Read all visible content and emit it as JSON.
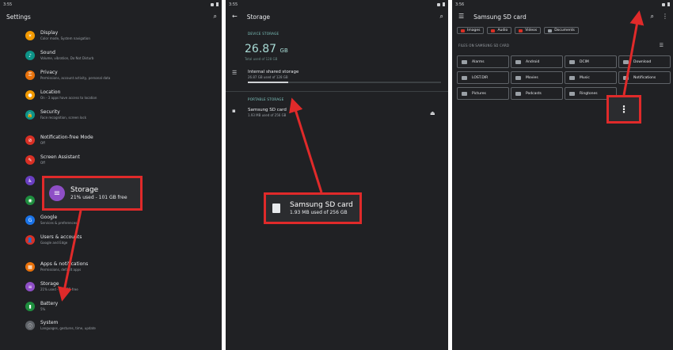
{
  "screen1": {
    "status_time": "3:55",
    "title": "Settings",
    "items": [
      {
        "title": "Display",
        "sub": "Color mode, System navigation",
        "color": "#f29900",
        "glyph": "☀"
      },
      {
        "title": "Sound",
        "sub": "Volume, vibration, Do Not Disturb",
        "color": "#0d9488",
        "glyph": "♪"
      },
      {
        "title": "Privacy",
        "sub": "Permissions, account activity, personal data",
        "color": "#e8710a",
        "glyph": "⚿"
      },
      {
        "title": "Location",
        "sub": "On - 3 apps have access to location",
        "color": "#f29900",
        "glyph": "●"
      },
      {
        "title": "Security",
        "sub": "Face recognition, screen lock",
        "color": "#0d9488",
        "glyph": "🔒"
      },
      {
        "title": "Notification-free Mode",
        "sub": "Off",
        "color": "#d93025",
        "glyph": "⊘"
      },
      {
        "title": "Screen Assistant",
        "sub": "Off",
        "color": "#d93025",
        "glyph": "✎"
      },
      {
        "title": "",
        "sub": "",
        "color": "#6a3fc2",
        "glyph": "♿"
      },
      {
        "title": "",
        "sub": "",
        "color": "#1e8e3e",
        "glyph": "◉"
      },
      {
        "title": "Google",
        "sub": "Services & preferences",
        "color": "#1a73e8",
        "glyph": "G"
      },
      {
        "title": "Users & accounts",
        "sub": "Google and Edge",
        "color": "#d93025",
        "glyph": "👤"
      },
      {
        "title": "Apps & notifications",
        "sub": "Permissions, default apps",
        "color": "#e8710a",
        "glyph": "▦"
      },
      {
        "title": "Storage",
        "sub": "21% used - 101 GB free",
        "color": "#8e4ec6",
        "glyph": "≡"
      },
      {
        "title": "Battery",
        "sub": "5%",
        "color": "#1e8e3e",
        "glyph": "▮"
      },
      {
        "title": "System",
        "sub": "Languages, gestures, time, update",
        "color": "#5f6368",
        "glyph": "ⓘ"
      }
    ],
    "callout": {
      "title": "Storage",
      "sub": "21% used - 101 GB free",
      "glyph": "≡"
    }
  },
  "screen2": {
    "status_time": "3:55",
    "title": "Storage",
    "device_label": "DEVICE STORAGE",
    "used_number": "26.87",
    "used_unit": "GB",
    "total_used": "Total used of 128 GB",
    "internal": {
      "title": "Internal shared storage",
      "sub": "26.87 GB used of 128 GB",
      "fraction": 0.21
    },
    "portable_label": "PORTABLE STORAGE",
    "sd": {
      "title": "Samsung SD card",
      "sub": "1.93 MB used of 256 GB"
    },
    "callout": {
      "title": "Samsung SD card",
      "sub": "1.93 MB used of 256 GB"
    }
  },
  "screen3": {
    "status_time": "3:56",
    "title": "Samsung SD card",
    "chips": [
      {
        "label": "Images",
        "color": "#d93025"
      },
      {
        "label": "Audio",
        "color": "#d93025"
      },
      {
        "label": "Videos",
        "color": "#d93025"
      },
      {
        "label": "Documents",
        "color": "#9aa0a6"
      }
    ],
    "files_label": "FILES ON SAMSUNG SD CARD",
    "folders": [
      "Alarms",
      "Android",
      "DCIM",
      "Download",
      "LOST.DIR",
      "Movies",
      "Music",
      "Notifications",
      "Pictures",
      "Podcasts",
      "Ringtones"
    ]
  }
}
